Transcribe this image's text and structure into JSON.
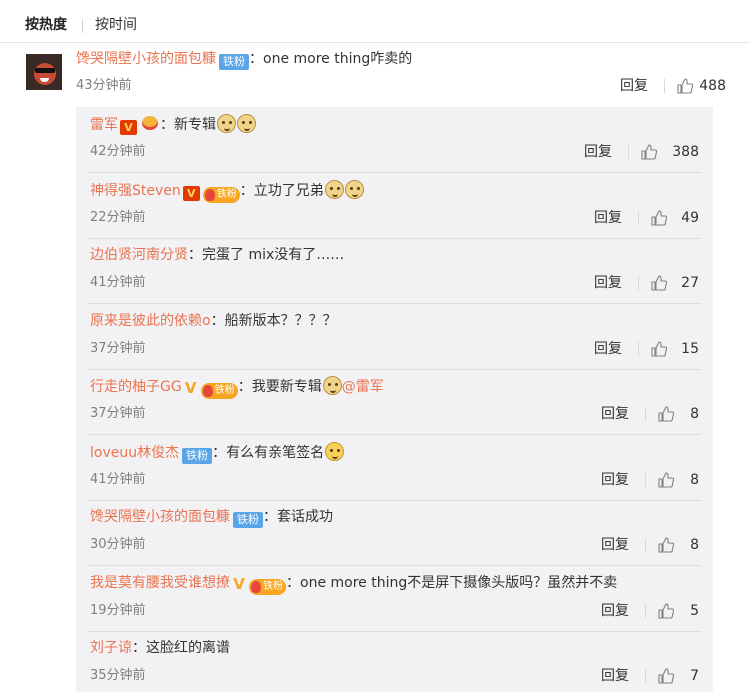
{
  "sort": {
    "hot": "按热度",
    "time": "按时间"
  },
  "main_comment": {
    "name": "馋哭隔壁小孩的面包糠",
    "badge": "铁粉",
    "text": "one more thing咋卖的",
    "time": "43分钟前",
    "reply_label": "回复",
    "likes": "488"
  },
  "replies": [
    {
      "name": "雷军",
      "badges": [
        "v-red",
        "hot-solo"
      ],
      "text": "新专辑",
      "emojis": [
        "doge",
        "doge"
      ],
      "time": "42分钟前",
      "reply_label": "回复",
      "likes": "388"
    },
    {
      "name": "神得强Steven",
      "badges": [
        "v-red",
        "hot-fan"
      ],
      "text": "立功了兄弟",
      "emojis": [
        "doge",
        "doge"
      ],
      "time": "22分钟前",
      "reply_label": "回复",
      "likes": "49"
    },
    {
      "name": "边伯贤河南分贤",
      "badges": [],
      "text": "完蛋了 mix没有了……",
      "emojis": [],
      "time": "41分钟前",
      "reply_label": "回复",
      "likes": "27"
    },
    {
      "name": "原来是彼此的依赖o",
      "badges": [],
      "text": "船新版本？？？？",
      "emojis": [],
      "time": "37分钟前",
      "reply_label": "回复",
      "likes": "15"
    },
    {
      "name": "行走的柚子GG",
      "badges": [
        "v-gold",
        "hot-fan"
      ],
      "text": "我要新专辑",
      "emojis": [
        "doge"
      ],
      "mention": "@雷军",
      "time": "37分钟前",
      "reply_label": "回复",
      "likes": "8"
    },
    {
      "name": "loveuu林俊杰",
      "badges": [
        "fan"
      ],
      "text": "有么有亲笔签名",
      "emojis": [
        "smirk"
      ],
      "time": "41分钟前",
      "reply_label": "回复",
      "likes": "8"
    },
    {
      "name": "馋哭隔壁小孩的面包糠",
      "badges": [
        "fan"
      ],
      "text": "套话成功",
      "emojis": [],
      "time": "30分钟前",
      "reply_label": "回复",
      "likes": "8"
    },
    {
      "name": "我是莫有腰我受谁想撩",
      "badges": [
        "v-gold",
        "hot-fan"
      ],
      "text": "one more thing不是屏下摄像头版吗？虽然并不卖",
      "emojis": [],
      "time": "19分钟前",
      "reply_label": "回复",
      "likes": "5"
    },
    {
      "name": "刘子谅",
      "badges": [],
      "text": "这脸红的离谱",
      "emojis": [],
      "time": "35分钟前",
      "reply_label": "回复",
      "likes": "7"
    }
  ],
  "badge_labels": {
    "fan": "铁粉",
    "v": "V"
  },
  "icons": {
    "like": "thumbs-up-icon"
  },
  "colors": {
    "name": "#eb7350",
    "fan_badge": "#5aa5e8",
    "v_badge": "#e23a00",
    "reply_bg": "#f2f2f5"
  }
}
